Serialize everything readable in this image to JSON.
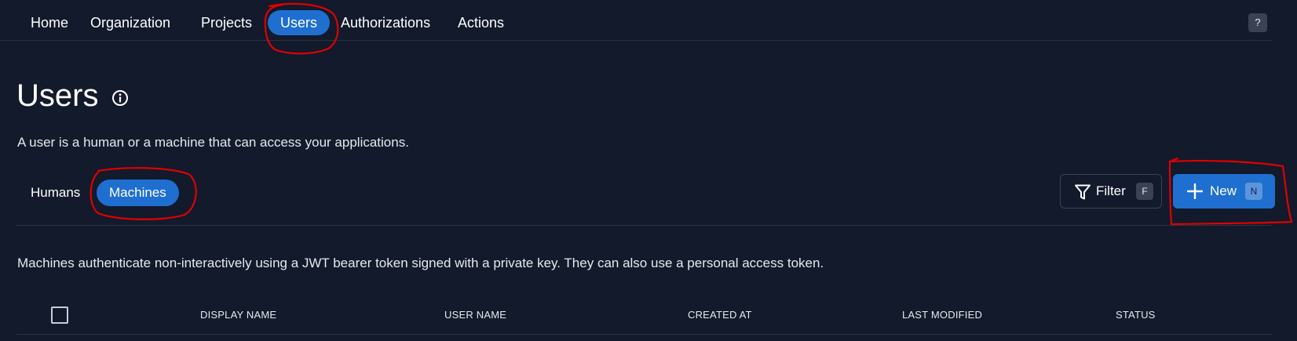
{
  "nav": {
    "items": [
      {
        "label": "Home"
      },
      {
        "label": "Organization"
      },
      {
        "label": "Projects"
      },
      {
        "label": "Users"
      },
      {
        "label": "Authorizations"
      },
      {
        "label": "Actions"
      }
    ],
    "active": "Users",
    "help_label": "?"
  },
  "page": {
    "title": "Users",
    "description": "A user is a human or a machine that can access your applications."
  },
  "tabs": {
    "items": [
      {
        "label": "Humans"
      },
      {
        "label": "Machines"
      }
    ],
    "active": "Machines"
  },
  "toolbar": {
    "filter_label": "Filter",
    "filter_shortcut": "F",
    "new_label": "New",
    "new_shortcut": "N"
  },
  "machines_description": "Machines authenticate non-interactively using a JWT bearer token signed with a private key. They can also use a personal access token.",
  "table": {
    "columns": [
      "DISPLAY NAME",
      "USER NAME",
      "CREATED AT",
      "LAST MODIFIED",
      "STATUS"
    ]
  },
  "icons": {
    "info": "info-circle-icon",
    "filter": "funnel-icon",
    "new": "plus-icon"
  },
  "colors": {
    "background": "#121a2b",
    "accent": "#1f6fd1",
    "annotation": "#e00000"
  }
}
